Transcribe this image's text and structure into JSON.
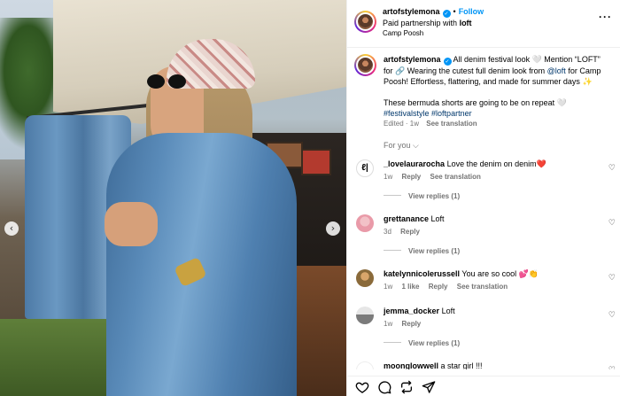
{
  "post": {
    "username": "artofstylemona",
    "follow_label": "Follow",
    "partnership_prefix": "Paid partnership with",
    "partner": "loft",
    "location": "Camp Poosh"
  },
  "caption": {
    "username": "artofstylemona",
    "part1": "All denim festival look 🤍 Mention “LOFT” for 🔗 Wearing the cutest full denim look from",
    "mention": "@loft",
    "part2": "for Camp Poosh! Effortless, flattering, and made for summer days ✨",
    "part3": "These bermuda shorts are going to be on repeat 🤍",
    "hashtag1": "#festivalstyle",
    "hashtag2": "#loftpartner",
    "edited": "Edited · 1w",
    "see_translation": "See translation"
  },
  "filter_label": "For you",
  "comments": [
    {
      "username": "_lovelaurarocha",
      "text": "Love the denim on denim❤️",
      "time": "1w",
      "reply": "Reply",
      "translation": "See translation",
      "view_replies": "View replies (1)"
    },
    {
      "username": "grettanance",
      "text": "Loft",
      "time": "3d",
      "reply": "Reply",
      "view_replies": "View replies (1)"
    },
    {
      "username": "katelynnicolerussell",
      "text": "You are so cool 💕👏",
      "time": "1w",
      "likes": "1 like",
      "reply": "Reply",
      "translation": "See translation"
    },
    {
      "username": "jemma_docker",
      "text": "Loft",
      "time": "1w",
      "reply": "Reply",
      "view_replies": "View replies (1)"
    },
    {
      "username": "moonglowwell",
      "text": "a star girl !!!"
    }
  ],
  "colors": {
    "accent": "#0095f6",
    "link": "#00376b",
    "muted": "#737373"
  },
  "icons": [
    "more-icon",
    "verified-icon",
    "heart-icon",
    "comment-icon",
    "share-icon",
    "send-icon",
    "chevron-left-icon",
    "chevron-right-icon"
  ]
}
